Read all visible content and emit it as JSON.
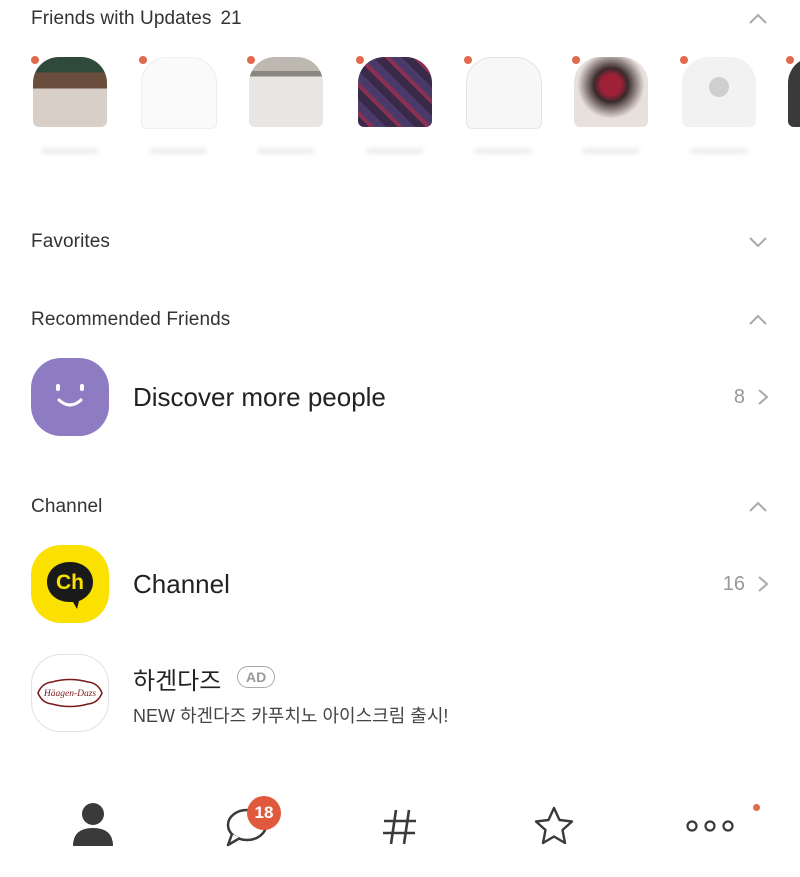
{
  "updates": {
    "title": "Friends with Updates",
    "count": "21",
    "items": [
      {
        "thumb": "photo-dark-green"
      },
      {
        "thumb": "blank"
      },
      {
        "thumb": "photo-gray"
      },
      {
        "thumb": "photo-plaid"
      },
      {
        "thumb": "sketch"
      },
      {
        "thumb": "photo-dark-red"
      },
      {
        "thumb": "default-avatar"
      },
      {
        "thumb": "partial"
      }
    ]
  },
  "favorites": {
    "title": "Favorites"
  },
  "recommended": {
    "title": "Recommended Friends",
    "discover_label": "Discover more people",
    "discover_count": "8",
    "avatar_color": "#8e7cc3"
  },
  "channel": {
    "title": "Channel",
    "label": "Channel",
    "count": "16",
    "icon_text": "Ch",
    "icon_color": "#fae100"
  },
  "ad": {
    "name": "하겐다즈",
    "badge": "AD",
    "description": "NEW 하겐다즈 카푸치노 아이스크림 출시!",
    "logo_text": "Häagen-Dazs"
  },
  "tabbar": {
    "chats_badge": "18",
    "tabs": [
      {
        "icon": "person-icon"
      },
      {
        "icon": "chat-bubble-icon"
      },
      {
        "icon": "hashtag-icon"
      },
      {
        "icon": "star-icon"
      },
      {
        "icon": "more-dots-icon"
      }
    ]
  },
  "colors": {
    "accent_dot": "#e06a4e",
    "badge": "#e0593d"
  }
}
